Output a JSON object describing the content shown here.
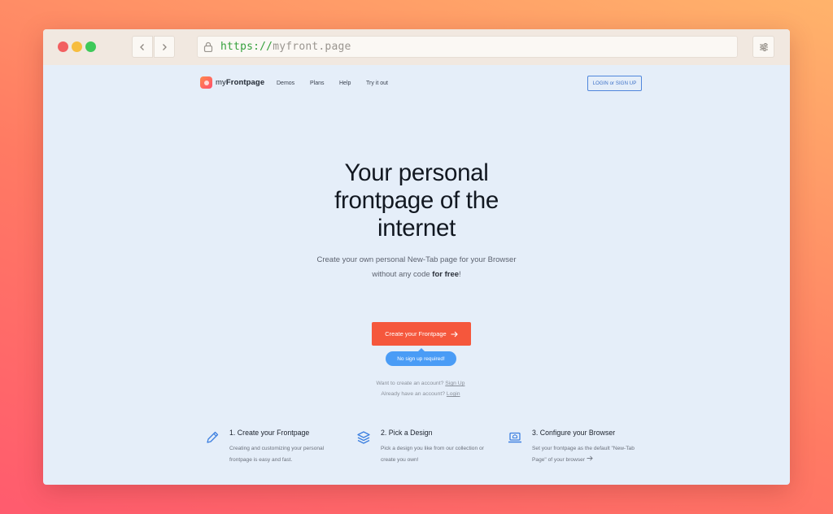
{
  "browser": {
    "url_protocol": "https://",
    "url_host": "myfront.page"
  },
  "site": {
    "logo_text_prefix": "my",
    "logo_text_bold": "Frontpage",
    "nav": [
      "Demos",
      "Plans",
      "Help",
      "Try it out"
    ],
    "login_label": "LOGIN or SIGN UP"
  },
  "hero": {
    "title": "Your personal frontpage of the internet",
    "subtitle_line1": "Create your own personal New-Tab page for your Browser",
    "subtitle_line2_start": "without any code ",
    "subtitle_line2_bold": "for free",
    "subtitle_line2_end": "!",
    "cta_label": "Create your Frontpage",
    "bubble_label": "No sign up required!",
    "account_prompt_1": "Want to create an account?",
    "account_link_1": "Sign Up",
    "account_prompt_2": "Already have an account?",
    "account_link_2": "Login"
  },
  "features": [
    {
      "icon": "pencil-icon",
      "title": "1. Create your Frontpage",
      "desc": "Creating and customizing your personal frontpage is easy and fast."
    },
    {
      "icon": "layers-icon",
      "title": "2. Pick a Design",
      "desc": "Pick a design you like from our collection or create you own!"
    },
    {
      "icon": "laptop-icon",
      "title": "3. Configure your Browser",
      "desc": "Set your frontpage as the default \"New-Tab Page\" of your browser"
    }
  ],
  "colors": {
    "cta": "#f5573c",
    "bubble": "#4a9cf6",
    "accent_blue": "#4f86dc",
    "page_bg": "#e5eef9"
  }
}
